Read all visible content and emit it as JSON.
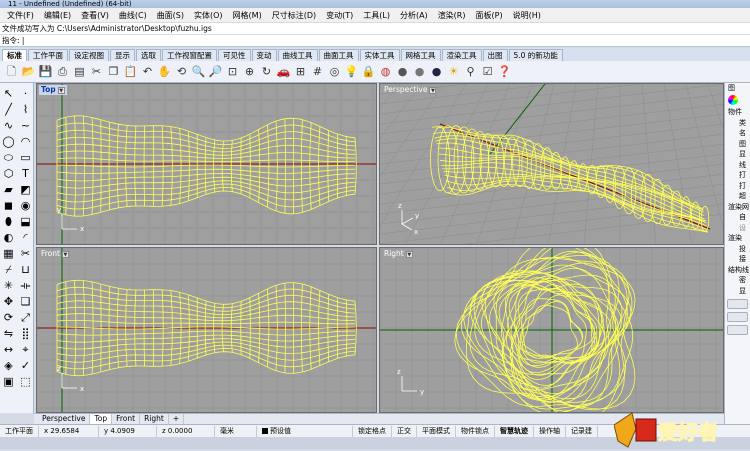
{
  "window": {
    "title": "11 - Undefined (Undefined) (64-bit)"
  },
  "menu": [
    "文件(F)",
    "编辑(E)",
    "查看(V)",
    "曲线(C)",
    "曲面(S)",
    "实体(O)",
    "网格(M)",
    "尺寸标注(D)",
    "变动(T)",
    "工具(L)",
    "分析(A)",
    "渲染(R)",
    "面板(P)",
    "说明(H)"
  ],
  "command": {
    "history": "文件成功写入为 C:\\Users\\Administrator\\Desktop\\fuzhu.igs",
    "prompt": "指令:"
  },
  "tabs": [
    "标准",
    "工作平面",
    "设定视图",
    "显示",
    "选取",
    "工作视窗配置",
    "可见性",
    "变动",
    "曲线工具",
    "曲面工具",
    "实体工具",
    "网格工具",
    "渲染工具",
    "出图",
    "5.0 的新功能"
  ],
  "toolbar_icons": [
    "new-icon",
    "open-icon",
    "save-icon",
    "print-icon",
    "import-icon",
    "cut-icon",
    "copy-icon",
    "paste-icon",
    "undo-icon",
    "pan-icon",
    "rotate-view-icon",
    "zoom-icon",
    "zoom-window-icon",
    "zoom-extents-icon",
    "zoom-selected-icon",
    "rotate-icon",
    "car-icon",
    "cplane-icon",
    "grid-icon",
    "osnap-icon",
    "light-icon",
    "lock-icon",
    "color-wheel-icon",
    "render-sphere-icon",
    "material-sphere-icon",
    "env-sphere-icon",
    "sun-icon",
    "filter-icon",
    "options-icon",
    "help-icon"
  ],
  "viewports": {
    "top": "Top",
    "perspective": "Perspective",
    "front": "Front",
    "right": "Right"
  },
  "axes": {
    "x": "x",
    "y": "y",
    "z": "z"
  },
  "viewport_tabs": [
    "Perspective",
    "Top",
    "Front",
    "Right"
  ],
  "add_tab": "+",
  "status": {
    "cplane": "工作平面",
    "x": "x 29.6584",
    "y": "y 4.0909",
    "z": "z 0.0000",
    "units": "毫米",
    "layer": "预设值",
    "toggles": [
      "锁定格点",
      "正交",
      "平面模式",
      "物件锁点",
      "智慧轨迹",
      "操作轴",
      "记录建"
    ]
  },
  "right_panel": {
    "header": "图",
    "section1": "物件",
    "rows1": [
      "类",
      "名",
      "图",
      "显",
      "线",
      "打",
      "打",
      "超"
    ],
    "section2": "渲染网",
    "rows2": [
      "自",
      "设"
    ],
    "section3": "渲染",
    "rows3": [
      "投",
      "接"
    ],
    "section4": "结构线",
    "rows4": [
      "密",
      "显"
    ]
  },
  "watermark": {
    "text": "爱好者"
  },
  "colors": {
    "wire": "#ffff55",
    "viewport_bg": "#9f9f9f",
    "grid": "#8c8c8c",
    "axis_x": "#8b0000",
    "axis_y": "#006400",
    "active_tab": "#ffffff"
  }
}
